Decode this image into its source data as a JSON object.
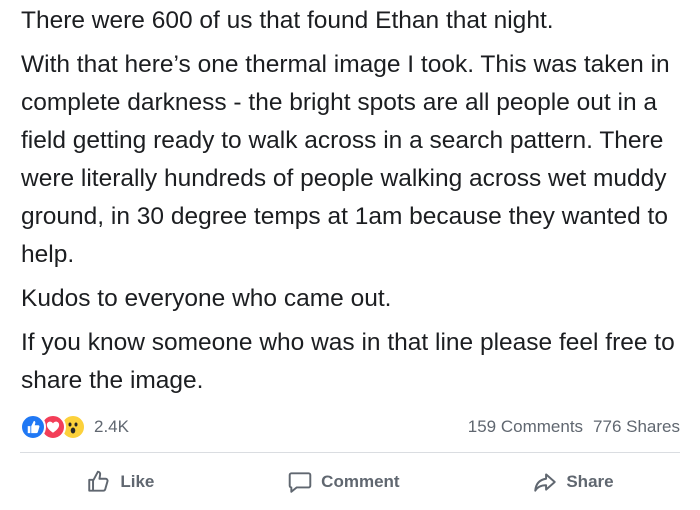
{
  "post": {
    "paragraphs": [
      "There were 600 of us that found Ethan that night.",
      "With that here’s one thermal image I took. This was taken in complete darkness - the bright spots are all people out in a field getting ready to walk across in a search pattern. There were literally hundreds of people walking across wet muddy ground, in 30 degree temps at 1am because they wanted to help.",
      "Kudos to everyone who came out.",
      "If you know someone who was in that line please feel free to share the image."
    ]
  },
  "stats": {
    "reactions": [
      "like-icon",
      "love-icon",
      "wow-icon"
    ],
    "reaction_count": "2.4K",
    "comments": "159 Comments",
    "shares": "776 Shares"
  },
  "actions": {
    "like_label": "Like",
    "comment_label": "Comment",
    "share_label": "Share"
  },
  "colors": {
    "text": "#1c1e21",
    "muted": "#606770",
    "like_blue": "#2078f4",
    "love_red": "#f33e58",
    "wow_yellow": "#fcd13b"
  }
}
